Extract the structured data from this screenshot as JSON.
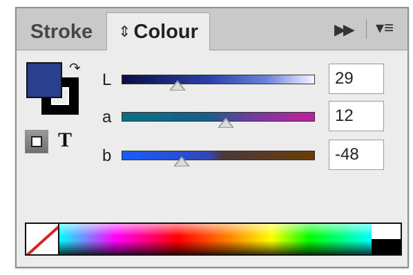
{
  "tabs": [
    {
      "label": "Stroke",
      "active": false
    },
    {
      "label": "Colour",
      "active": true
    }
  ],
  "icons": {
    "tab_cycle": "updown-arrows-icon",
    "panel_expand": "double-chevron-right-icon",
    "panel_menu": "panel-menu-icon",
    "swap": "swap-fill-stroke-icon"
  },
  "swatches": {
    "fill_color": "#2b3f8f",
    "stroke_color": "#000000"
  },
  "text_button_label": "T",
  "channels": [
    {
      "label": "L",
      "value": "29",
      "level": 0.29
    },
    {
      "label": "a",
      "value": "12",
      "level": 0.54
    },
    {
      "label": "b",
      "value": "-48",
      "level": 0.31
    }
  ]
}
